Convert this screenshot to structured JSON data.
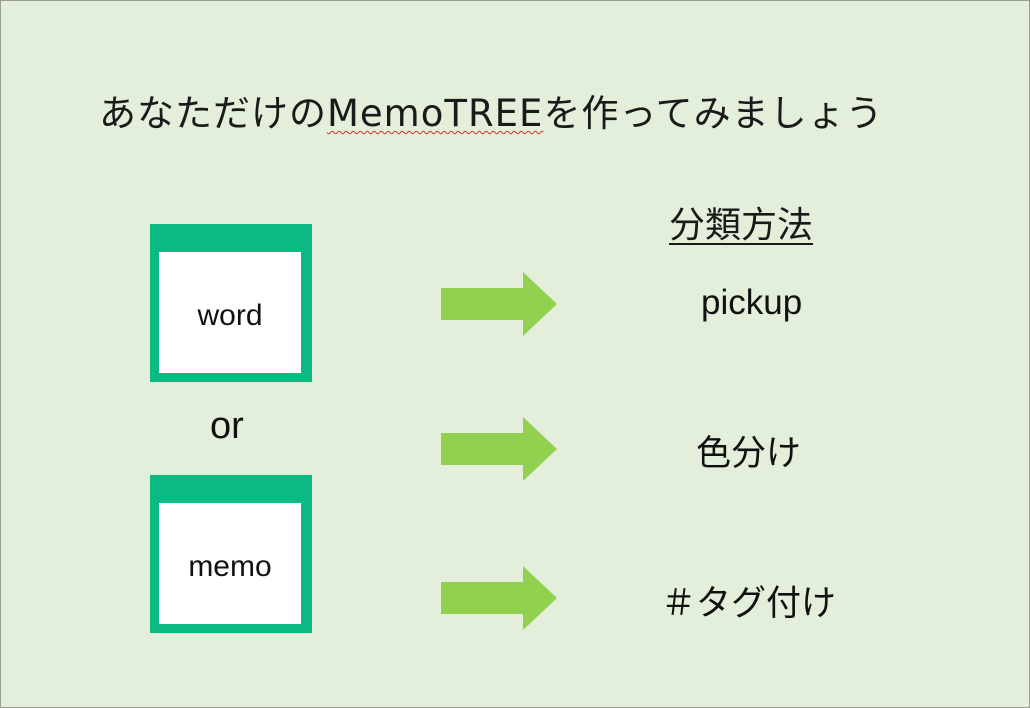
{
  "title": {
    "prefix": "あなただけの",
    "app_name": "MemoTREE",
    "suffix": "を作ってみましょう"
  },
  "inputs": {
    "word_label": "word",
    "connector": "or",
    "memo_label": "memo"
  },
  "methods": {
    "heading": "分類方法",
    "items": [
      "pickup",
      "色分け",
      "＃タグ付け"
    ]
  },
  "colors": {
    "background": "#e3efda",
    "card_frame": "#0aba82",
    "arrow": "#92d050"
  }
}
